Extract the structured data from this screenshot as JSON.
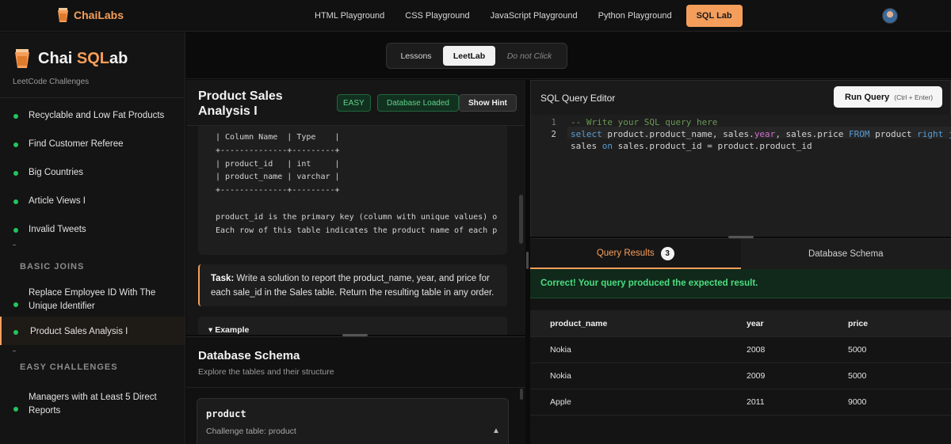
{
  "brand": {
    "name": "ChaiLabs"
  },
  "nav": {
    "links": [
      "HTML Playground",
      "CSS Playground",
      "JavaScript Playground",
      "Python Playground"
    ],
    "active": "SQL Lab"
  },
  "sidebar": {
    "title_pre": "Chai ",
    "title_sql": "SQL",
    "title_post": "ab",
    "subtitle": "LeetCode Challenges",
    "items": [
      "Recyclable and Low Fat Products",
      "Find Customer Referee",
      "Big Countries",
      "Article Views I",
      "Invalid Tweets"
    ],
    "section_joins": "BASIC JOINS",
    "joins": [
      "Replace Employee ID With The Unique Identifier",
      "Product Sales Analysis I"
    ],
    "section_easy": "EASY CHALLENGES",
    "easy": [
      "Managers with at Least 5 Direct Reports"
    ]
  },
  "modes": {
    "lessons": "Lessons",
    "leetlab": "LeetLab",
    "donot": "Do not Click"
  },
  "problem": {
    "title": "Product Sales Analysis I",
    "difficulty": "EASY",
    "db_status": "Database Loaded",
    "hint": "Show Hint",
    "schema_text": "| Column Name  | Type    |\n+--------------+---------+\n| product_id   | int     |\n| product_name | varchar |\n+--------------+---------+\n\nproduct_id is the primary key (column with unique values) o\nEach row of this table indicates the product name of each p",
    "task_label": "Task:",
    "task_text": " Write a solution to report the product_name, year, and price for each sale_id in the Sales table. Return the resulting table in any order.",
    "example_label": "▾ Example"
  },
  "db_schema": {
    "title": "Database Schema",
    "subtitle": "Explore the tables and their structure",
    "table_name": "product",
    "table_desc": "Challenge table: product",
    "caret": "▲"
  },
  "editor": {
    "label": "SQL Query Editor",
    "run_label": "Run Query",
    "run_shortcut": "(Ctrl + Enter)",
    "line_numbers": [
      "1",
      "2"
    ],
    "comment": "-- Write your SQL query here"
  },
  "results": {
    "tab_results": "Query Results",
    "count": "3",
    "tab_schema": "Database Schema",
    "success": "Correct! Your query produced the expected result.",
    "columns": [
      "product_name",
      "year",
      "price"
    ],
    "rows": [
      [
        "Nokia",
        "2008",
        "5000"
      ],
      [
        "Nokia",
        "2009",
        "5000"
      ],
      [
        "Apple",
        "2011",
        "9000"
      ]
    ]
  }
}
